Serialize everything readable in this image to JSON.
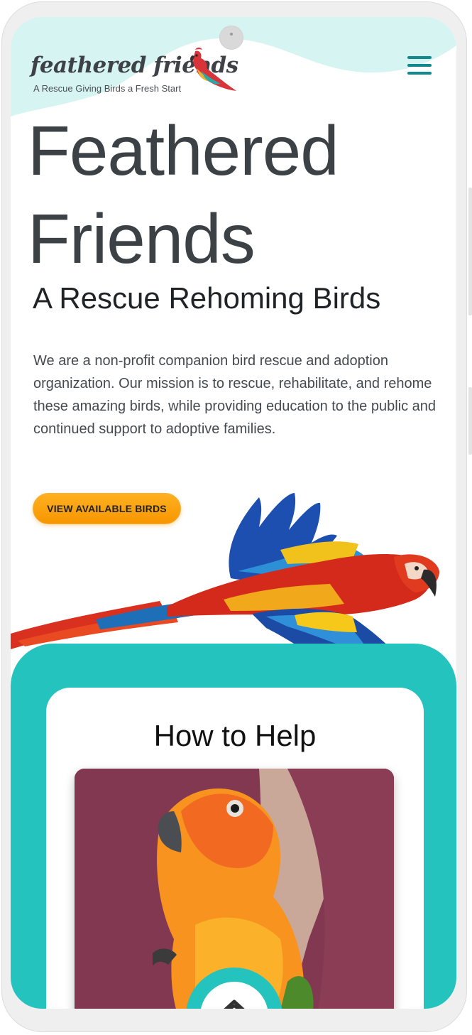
{
  "brand": {
    "name": "feathered friends",
    "tagline": "A Rescue Giving Birds a Fresh Start"
  },
  "hero": {
    "title": "Feathered Friends",
    "subtitle": "A Rescue Rehoming Birds",
    "description": "We are a non-profit companion bird rescue and adoption organization. Our mission is to rescue, rehabilitate, and rehome these amazing birds, while providing education to the public and continued support to adoptive families.",
    "cta_label": "VIEW AVAILABLE BIRDS"
  },
  "help": {
    "title": "How to Help"
  },
  "icons": {
    "menu": "hamburger-menu-icon",
    "home": "home-icon",
    "logo": "parrot-logo-icon"
  },
  "colors": {
    "teal": "#25c3bd",
    "teal_dark": "#11898d",
    "mint_wave": "#d6f4f2",
    "cta_orange": "#f9a00e",
    "title_gray": "#3c4145"
  }
}
